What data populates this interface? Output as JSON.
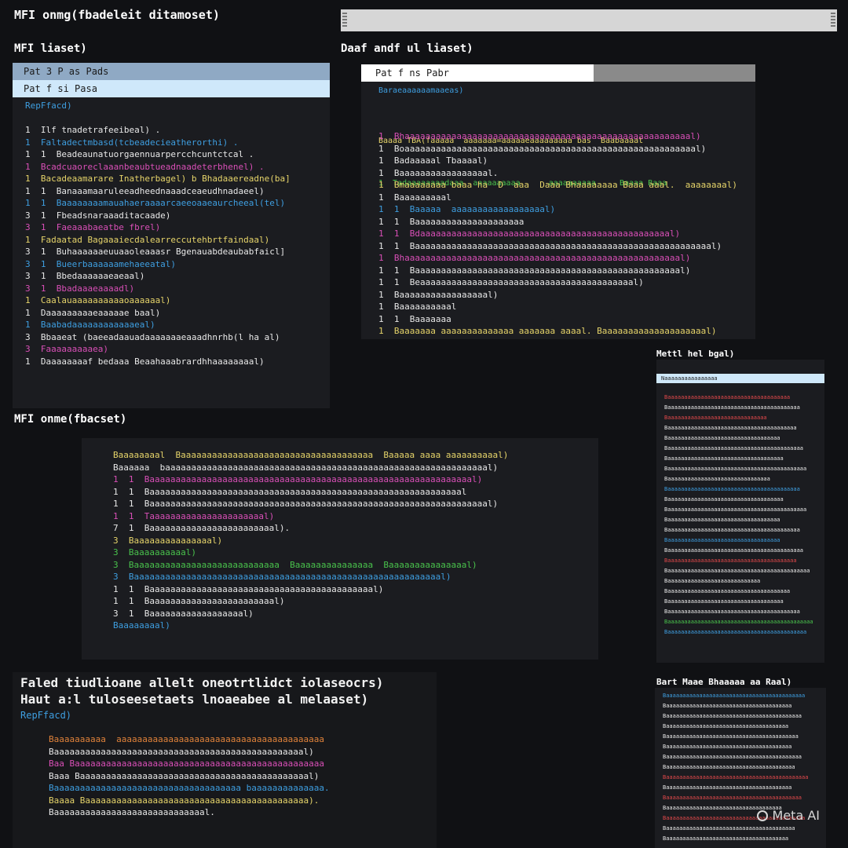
{
  "colors": {
    "background": "#101114",
    "panel": "#1b1c20",
    "highlight_light": "#cfe8fa",
    "highlight_mid": "#8fa9c4",
    "text_white": "#e8e8e8",
    "text_yellow": "#e6d46a",
    "text_pink": "#d94fb7",
    "text_blue": "#3e9ee0",
    "text_green": "#49c24c",
    "text_red": "#e0484a",
    "text_orange": "#e0823a"
  },
  "top_bar": {
    "heading": "MFI onmg(fbadeleit ditamoset)"
  },
  "panel_a": {
    "heading": "MFI liaset)",
    "row_selected": "Pat 3 P as Pads",
    "row_highlight": "Pat f si Pasa",
    "sub": "RepFfacd)",
    "lines": [
      {
        "t": "1  Ilf tnadetrafeeibeal) .",
        "c": "text_white"
      },
      {
        "t": "1  Faltadectmbasd(tcbeadecieatherorthi) .",
        "c": "text_blue"
      },
      {
        "t": "1  1  Beadeaunatuorgaennuarpercchcuntctcal .",
        "c": "text_white"
      },
      {
        "t": "1  Bcadcuaoreclaaanbeaubtueadnaadeterbhenel) .",
        "c": "text_pink"
      },
      {
        "t": "1  Bacadeaamarare Inatherbagel) b Bhadaaereadne(ba]",
        "c": "text_yellow"
      },
      {
        "t": "1  1  Banaaamaaruleeadheednaaadceaeudhnadaeel)",
        "c": "text_white"
      },
      {
        "t": "1  1  Baaaaaaaamauahaeraaaarcaeeoaaeaurcheeal(tel)",
        "c": "text_blue"
      },
      {
        "t": "3  1  Fbeadsnaraaaditacaade)",
        "c": "text_white"
      },
      {
        "t": "3  1  Faeaaabaeatbe fbrel)",
        "c": "text_pink"
      },
      {
        "t": "1  Fadaatad Bagaaaiecdalearreccutehbrtfaindaal)",
        "c": "text_yellow"
      },
      {
        "t": "3  1  Buhaaaaaaeuuaaoleaaasr Bgenauabdeaubabfaicl]",
        "c": "text_white"
      },
      {
        "t": "3  1  Bueerbaaaaaamehaeeatal)",
        "c": "text_blue"
      },
      {
        "t": "3  1  Bbedaaaaaaeaeaal)",
        "c": "text_white"
      },
      {
        "t": "3  1  Bbadaaaeaaaadl)",
        "c": "text_pink"
      },
      {
        "t": "1  Caalauaaaaaaaaaaoaaaaaal)",
        "c": "text_yellow"
      },
      {
        "t": "1  Daaaaaaaaaeaaaaae baal)",
        "c": "text_white"
      },
      {
        "t": "1  Baabadaaaaaaaaaaaaeal)",
        "c": "text_blue"
      },
      {
        "t": "3  Bbaaeat (baeeadaauadaaaaaaaeaaadhnrhb(l ha al)",
        "c": "text_white"
      },
      {
        "t": "3  Faaaaaaaaaea)",
        "c": "text_pink"
      },
      {
        "t": "1  Daaaaaaaaf bedaaa Beaahaaabrardhhaaaaaaaal)",
        "c": "text_white"
      }
    ]
  },
  "panel_b": {
    "heading": "Daaf andf ul liaset)",
    "row_selected": "Pat f ns Pabr",
    "sub": "Baraeaaaaaamaaeas)",
    "header_line": "Baaaa TBA(faaaaa  aaaaaaa=aaaaaeaaaaaaaaa bas  Baabaaaat",
    "header_line2": "1  Tadaaaaaaaadaaa  aaaaaaaaaa      aaaaaaaaaa     Baaaa Baaa",
    "lines": [
      {
        "t": "1  Bhaaaaaaaaaaaaaaaaaaaaaaaaaaaaaaaaaaaaaaaaaaaaaaaaaaaaaaal)",
        "c": "text_pink"
      },
      {
        "t": "1  Boaaaaaaaaaaaaaaaaaaaaaaaaaaaaaaaaaaaaaaaaaaaaaaaaaaaaaaaal)",
        "c": "text_white"
      },
      {
        "t": "1  Badaaaaal Tbaaaal)",
        "c": "text_white"
      },
      {
        "t": "1  Baaaaaaaaaaaaaaaaal.",
        "c": "text_white"
      },
      {
        "t": "1  Bmaaaaaaaa baaa ha  D  aaa  Daaa Bhaaaaaaaa Baaa aaal.  aaaaaaaal)",
        "c": "text_yellow"
      },
      {
        "t": "1  Baaaaaaaaal",
        "c": "text_white"
      },
      {
        "t": "1  1  Baaaaa  aaaaaaaaaaaaaaaaaal)",
        "c": "text_blue"
      },
      {
        "t": "1  1  Baaaaaaaaaaaaaaaaaaaaa",
        "c": "text_white"
      },
      {
        "t": "1  1  Bdaaaaaaaaaaaaaaaaaaaaaaaaaaaaaaaaaaaaaaaaaaaaaaaal)",
        "c": "text_pink"
      },
      {
        "t": "1  1  Baaaaaaaaaaaaaaaaaaaaaaaaaaaaaaaaaaaaaaaaaaaaaaaaaaaaaaaaal)",
        "c": "text_white"
      },
      {
        "t": "1  Bhaaaaaaaaaaaaaaaaaaaaaaaaaaaaaaaaaaaaaaaaaaaaaaaaaaaaal)",
        "c": "text_pink"
      },
      {
        "t": "1  1  Baaaaaaaaaaaaaaaaaaaaaaaaaaaaaaaaaaaaaaaaaaaaaaaaaaal)",
        "c": "text_white"
      },
      {
        "t": "1  1  Beaaaaaaaaaaaaaaaaaaaaaaaaaaaaaaaaaaaaaaaaal)",
        "c": "text_white"
      },
      {
        "t": "1  Baaaaaaaaaaaaaaaaal)",
        "c": "text_white"
      },
      {
        "t": "1  Baaaaaaaaaal",
        "c": "text_white"
      },
      {
        "t": "1  1  Baaaaaaa",
        "c": "text_white"
      },
      {
        "t": "1  Baaaaaaa aaaaaaaaaaaaaa aaaaaaa aaaal. Baaaaaaaaaaaaaaaaaaaal)",
        "c": "text_yellow"
      }
    ]
  },
  "panel_c": {
    "heading": "MFI onme(fbacset)",
    "lines": [
      {
        "t": "Baaaaaaaal  Baaaaaaaaaaaaaaaaaaaaaaaaaaaaaaaaaaaaa  Baaaaa aaaa aaaaaaaaaal)",
        "c": "text_yellow"
      },
      {
        "t": "Baaaaaa  baaaaaaaaaaaaaaaaaaaaaaaaaaaaaaaaaaaaaaaaaaaaaaaaaaaaaaaaaaaaaal)",
        "c": "text_white"
      },
      {
        "t": "1  1  Baaaaaaaaaaaaaaaaaaaaaaaaaaaaaaaaaaaaaaaaaaaaaaaaaaaaaaaaaaaaaal)",
        "c": "text_pink"
      },
      {
        "t": "1  1  Baaaaaaaaaaaaaaaaaaaaaaaaaaaaaaaaaaaaaaaaaaaaaaaaaaaaaaaaaaaal",
        "c": "text_white"
      },
      {
        "t": "1  1  Baaaaaaaaaaaaaaaaaaaaaaaaaaaaaaaaaaaaaaaaaaaaaaaaaaaaaaaaaaaaaaaaal)",
        "c": "text_white"
      },
      {
        "t": "1  1  Taaaaaaaaaaaaaaaaaaaaaal)",
        "c": "text_pink"
      },
      {
        "t": "7  1  Baaaaaaaaaaaaaaaaaaaaaaaal).",
        "c": "text_white"
      },
      {
        "t": "3  Baaaaaaaaaaaaaaal)",
        "c": "text_yellow"
      },
      {
        "t": "3  Baaaaaaaaaal)",
        "c": "text_green"
      },
      {
        "t": "3  Baaaaaaaaaaaaaaaaaaaaaaaaaaaa  Baaaaaaaaaaaaaaa  Baaaaaaaaaaaaaaal)",
        "c": "text_green"
      },
      {
        "t": "3  Baaaaaaaaaaaaaaaaaaaaaaaaaaaaaaaaaaaaaaaaaaaaaaaaaaaaaaaaaaal)",
        "c": "text_blue"
      },
      {
        "t": "1  1  Baaaaaaaaaaaaaaaaaaaaaaaaaaaaaaaaaaaaaaaaaaal)",
        "c": "text_white"
      },
      {
        "t": "1  1  Baaaaaaaaaaaaaaaaaaaaaaaal)",
        "c": "text_white"
      },
      {
        "t": "3  1  Baaaaaaaaaaaaaaaaaal)",
        "c": "text_white"
      },
      {
        "t": "Baaaaaaaal)",
        "c": "text_blue"
      }
    ]
  },
  "panel_d": {
    "heading1": "Faled tiudlioane allelt oneotrtlidct iolaseocrs)",
    "heading2": "Haut  a:l  tuloseesetaets  lnoaeabee  al melaaset)",
    "sub": "RepFfacd)",
    "lines": [
      {
        "t": "Baaaaaaaaaa  aaaaaaaaaaaaaaaaaaaaaaaaaaaaaaaaaaaaaaaa",
        "c": "text_orange"
      },
      {
        "t": "Baaaaaaaaaaaaaaaaaaaaaaaaaaaaaaaaaaaaaaaaaaaaaaaal)",
        "c": "text_white"
      },
      {
        "t": "Baa Baaaaaaaaaaaaaaaaaaaaaaaaaaaaaaaaaaaaaaaaaaaaaaaa",
        "c": "text_pink"
      },
      {
        "t": "Baaa Baaaaaaaaaaaaaaaaaaaaaaaaaaaaaaaaaaaaaaaaaaaal)",
        "c": "text_white"
      },
      {
        "t": "Baaaaaaaaaaaaaaaaaaaaaaaaaaaaaaaaaaaa baaaaaaaaaaaaaa.",
        "c": "text_blue"
      },
      {
        "t": "Baaaa Baaaaaaaaaaaaaaaaaaaaaaaaaaaaaaaaaaaaaaaaaaa).",
        "c": "text_yellow"
      },
      {
        "t": "Baaaaaaaaaaaaaaaaaaaaaaaaaaaaal.",
        "c": "text_white"
      }
    ]
  },
  "mini_1": {
    "heading": "Mettl hel bgal)",
    "row_selected": "Naaaaaaaaaaaaaaaa",
    "lines": [
      {
        "t": "Baaaaaaaaaaaaaaaaaaaaaaaaaaaaaaaaaaaaa",
        "c": "text_red"
      },
      {
        "t": "Baaaaaaaaaaaaaaaaaaaaaaaaaaaaaaaaaaaaaaaa",
        "c": "text_white"
      },
      {
        "t": "Baaaaaaaaaaaaaaaaaaaaaaaaaaaaaa",
        "c": "text_red"
      },
      {
        "t": "Baaaaaaaaaaaaaaaaaaaaaaaaaaaaaaaaaaaaaaa",
        "c": "text_white"
      },
      {
        "t": "Baaaaaaaaaaaaaaaaaaaaaaaaaaaaaaaaaa",
        "c": "text_white"
      },
      {
        "t": "Baaaaaaaaaaaaaaaaaaaaaaaaaaaaaaaaaaaaaaaaa",
        "c": "text_white"
      },
      {
        "t": "Baaaaaaaaaaaaaaaaaaaaaaaaaaaaaaaaaaa",
        "c": "text_white"
      },
      {
        "t": "Baaaaaaaaaaaaaaaaaaaaaaaaaaaaaaaaaaaaaaaaaa",
        "c": "text_white"
      },
      {
        "t": "Baaaaaaaaaaaaaaaaaaaaaaaaaaaaaaa",
        "c": "text_white"
      },
      {
        "t": "Baaaaaaaaaaaaaaaaaaaaaaaaaaaaaaaaaaaaaaaa",
        "c": "text_blue"
      },
      {
        "t": "Baaaaaaaaaaaaaaaaaaaaaaaaaaaaaaaaaaa",
        "c": "text_white"
      },
      {
        "t": "Baaaaaaaaaaaaaaaaaaaaaaaaaaaaaaaaaaaaaaaaaa",
        "c": "text_white"
      },
      {
        "t": "Baaaaaaaaaaaaaaaaaaaaaaaaaaaaaaaaaa",
        "c": "text_white"
      },
      {
        "t": "Baaaaaaaaaaaaaaaaaaaaaaaaaaaaaaaaaaaaaaaa",
        "c": "text_white"
      },
      {
        "t": "Baaaaaaaaaaaaaaaaaaaaaaaaaaaaaaaaaa",
        "c": "text_blue"
      },
      {
        "t": "Baaaaaaaaaaaaaaaaaaaaaaaaaaaaaaaaaaaaaaaaa",
        "c": "text_white"
      },
      {
        "t": "Baaaaaaaaaaaaaaaaaaaaaaaaaaaaaaaaaaaaaaa",
        "c": "text_red"
      },
      {
        "t": "Baaaaaaaaaaaaaaaaaaaaaaaaaaaaaaaaaaaaaaaaaaa",
        "c": "text_white"
      },
      {
        "t": "Baaaaaaaaaaaaaaaaaaaaaaaaaaaa",
        "c": "text_white"
      },
      {
        "t": "Baaaaaaaaaaaaaaaaaaaaaaaaaaaaaaaaaaaaa",
        "c": "text_white"
      },
      {
        "t": "Baaaaaaaaaaaaaaaaaaaaaaaaaaaaaaaaaaa",
        "c": "text_white"
      },
      {
        "t": "Baaaaaaaaaaaaaaaaaaaaaaaaaaaaaaaaaaaaaaaa",
        "c": "text_white"
      },
      {
        "t": "Baaaaaaaaaaaaaaaaaaaaaaaaaaaaaaaaaaaaaaaaaaaa",
        "c": "text_green"
      },
      {
        "t": "Baaaaaaaaaaaaaaaaaaaaaaaaaaaaaaaaaaaaaaaaaa",
        "c": "text_blue"
      }
    ]
  },
  "mini_2": {
    "heading": "Bart Maae Bhaaaaa aa Raal)",
    "lines": [
      {
        "t": "Baaaaaaaaaaaaaaaaaaaaaaaaaaaaaaaaaaaaaaaaaa",
        "c": "text_blue"
      },
      {
        "t": "Baaaaaaaaaaaaaaaaaaaaaaaaaaaaaaaaaaaaaa",
        "c": "text_white"
      },
      {
        "t": "Baaaaaaaaaaaaaaaaaaaaaaaaaaaaaaaaaaaaaaaaa",
        "c": "text_white"
      },
      {
        "t": "Baaaaaaaaaaaaaaaaaaaaaaaaaaaaaaaaaaaaa",
        "c": "text_white"
      },
      {
        "t": "Baaaaaaaaaaaaaaaaaaaaaaaaaaaaaaaaaaaaaaaa",
        "c": "text_white"
      },
      {
        "t": "Baaaaaaaaaaaaaaaaaaaaaaaaaaaaaaaaaaaaaa",
        "c": "text_white"
      },
      {
        "t": "Baaaaaaaaaaaaaaaaaaaaaaaaaaaaaaaaaaaaaaaaa",
        "c": "text_white"
      },
      {
        "t": "Baaaaaaaaaaaaaaaaaaaaaaaaaaaaaaaaaaaaaaa",
        "c": "text_white"
      },
      {
        "t": "Baaaaaaaaaaaaaaaaaaaaaaaaaaaaaaaaaaaaaaaaaaa",
        "c": "text_red"
      },
      {
        "t": "Baaaaaaaaaaaaaaaaaaaaaaaaaaaaaaaaaaaaaa",
        "c": "text_white"
      },
      {
        "t": "Baaaaaaaaaaaaaaaaaaaaaaaaaaaaaaaaaaaaaaaaa",
        "c": "text_red"
      },
      {
        "t": "Baaaaaaaaaaaaaaaaaaaaaaaaaaaaaaaaaaa",
        "c": "text_white"
      },
      {
        "t": "Baaaaaaaaaaaaaaaaaaaaaaaaaaaaaaaaaaaaaaaaaa",
        "c": "text_red"
      },
      {
        "t": "Baaaaaaaaaaaaaaaaaaaaaaaaaaaaaaaaaaaaaaa",
        "c": "text_white"
      },
      {
        "t": "Baaaaaaaaaaaaaaaaaaaaaaaaaaaaaaaaaaaaa",
        "c": "text_white"
      }
    ]
  },
  "watermark": {
    "text": "Meta AI"
  }
}
